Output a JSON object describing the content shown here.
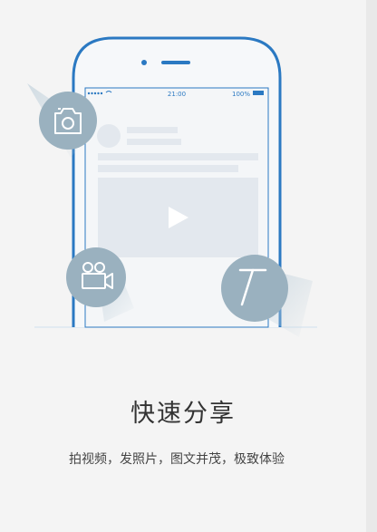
{
  "phone": {
    "status_time": "21:00",
    "status_battery": "100%"
  },
  "feature": {
    "title": "快速分享",
    "subtitle": "拍视频，发照片，图文并茂，极致体验"
  },
  "icons": {
    "camera": "camera-icon",
    "video_camera": "video-camera-icon",
    "text": "text-icon",
    "play": "play-icon"
  },
  "colors": {
    "background": "#f4f4f4",
    "phone_outline": "#2b79c2",
    "icon_circle": "#9ab1bf",
    "headline": "#333333"
  }
}
